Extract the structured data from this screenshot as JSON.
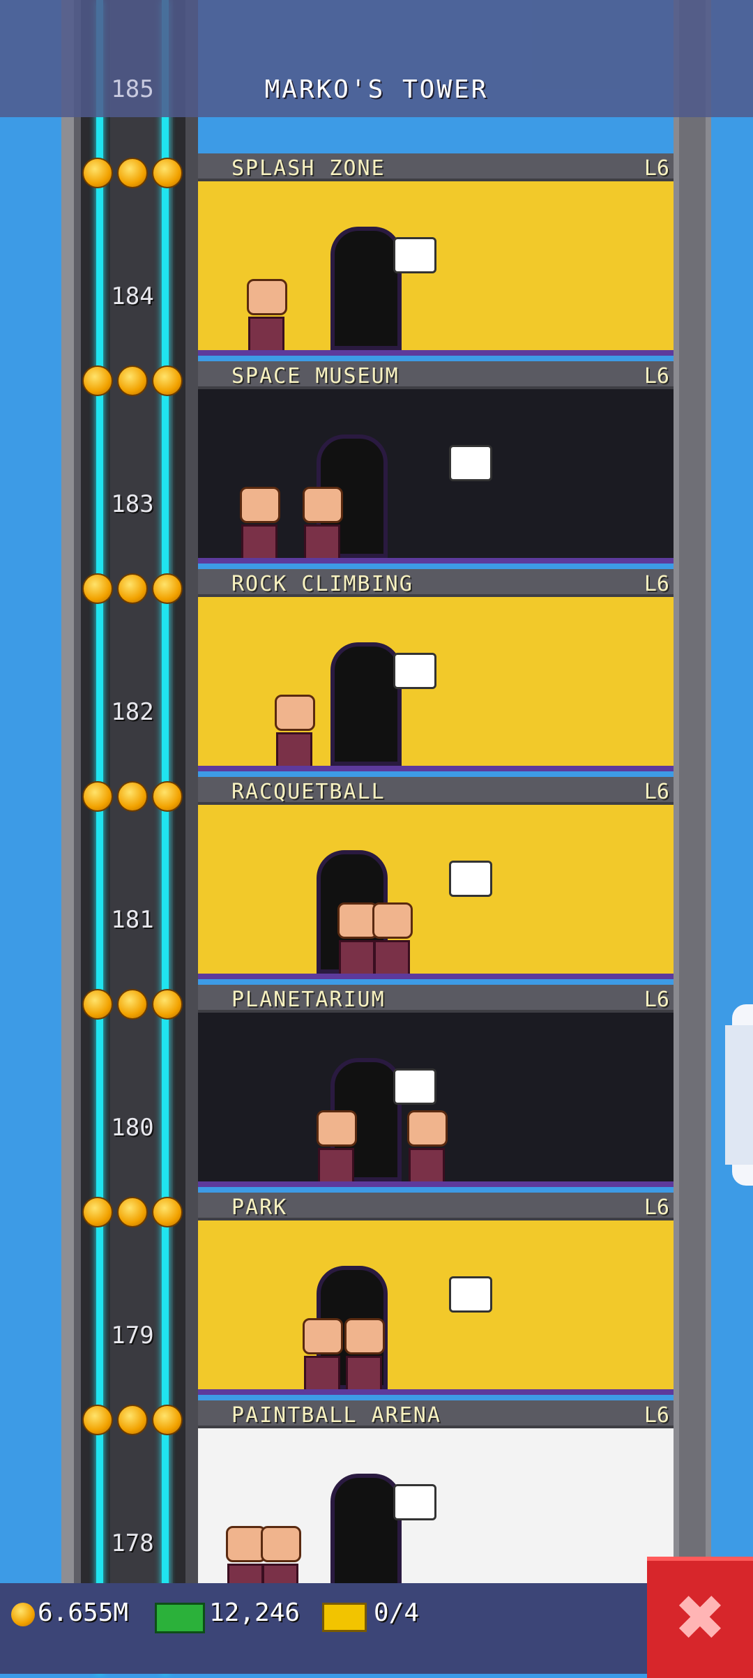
{
  "header": {
    "title": "MARKO'S TOWER",
    "top_floor_number": "185"
  },
  "floors": [
    {
      "number": "184",
      "name": "SPLASH ZONE",
      "level": "L6",
      "stars": 3,
      "bg": "#f2c92a"
    },
    {
      "number": "183",
      "name": "SPACE MUSEUM",
      "level": "L6",
      "stars": 3,
      "bg": "#1b1b22"
    },
    {
      "number": "182",
      "name": "ROCK CLIMBING",
      "level": "L6",
      "stars": 3,
      "bg": "#f2c92a"
    },
    {
      "number": "181",
      "name": "RACQUETBALL",
      "level": "L6",
      "stars": 3,
      "bg": "#f2c92a"
    },
    {
      "number": "180",
      "name": "PLANETARIUM",
      "level": "L6",
      "stars": 3,
      "bg": "#1b1b22"
    },
    {
      "number": "179",
      "name": "PARK",
      "level": "L6",
      "stars": 3,
      "bg": "#f2c92a"
    },
    {
      "number": "178",
      "name": "PAINTBALL ARENA",
      "level": "L6",
      "stars": 3,
      "bg": "#f3f3f3"
    }
  ],
  "status_bar": {
    "coins": "6.655M",
    "bux": "12,246",
    "tickets": "0/4"
  },
  "icons": {
    "coin": "coin-icon",
    "bux": "cash-icon",
    "ticket": "ticket-icon",
    "close": "close-icon",
    "star": "star-icon"
  },
  "close_button": {
    "glyph": "✖"
  }
}
